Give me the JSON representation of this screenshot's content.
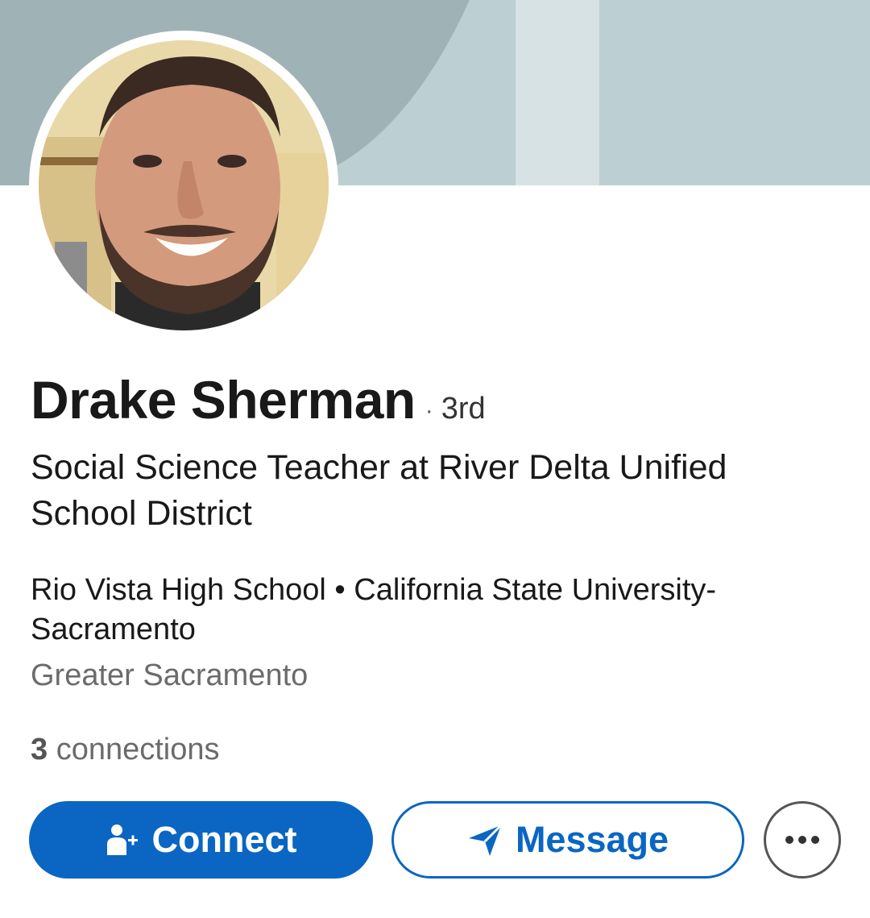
{
  "profile": {
    "name": "Drake Sherman",
    "degree_separator": "·",
    "degree": "3rd",
    "headline": "Social Science Teacher at River Delta Unified School District",
    "education": "Rio Vista High School • California State University-Sacramento",
    "location": "Greater Sacramento",
    "connections_count": "3",
    "connections_label": " connections",
    "avatar_icon": "profile-photo"
  },
  "actions": {
    "connect_label": "Connect",
    "message_label": "Message",
    "more_icon": "more-icon"
  },
  "colors": {
    "brand_blue": "#0a66c2",
    "cover_dark": "#9fb3b7",
    "cover_light": "#bccfd3"
  }
}
